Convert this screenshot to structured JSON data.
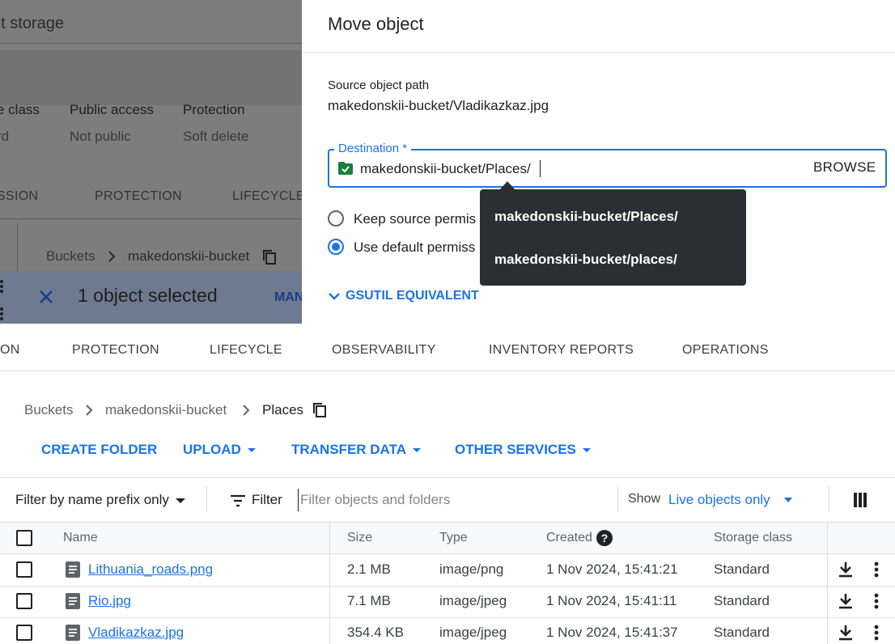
{
  "background_page": {
    "title": "et storage",
    "columns": [
      {
        "header": "e class",
        "value": "rd"
      },
      {
        "header": "Public access",
        "value": "Not public"
      },
      {
        "header": "Protection",
        "value": "Soft delete"
      }
    ],
    "tabs": [
      "SSION",
      "PROTECTION",
      "LIFECYCLE"
    ],
    "breadcrumb": [
      "Buckets",
      "makedonskii-bucket"
    ],
    "selection_text": "1 object selected",
    "selection_action": "MAN"
  },
  "dialog": {
    "title": "Move object",
    "source_label": "Source object path",
    "source_value": "makedonskii-bucket/Vladikazkaz.jpg",
    "destination_label": "Destination *",
    "destination_value": "makedonskii-bucket/Places/",
    "browse_label": "BROWSE",
    "radio_keep": "Keep source permis",
    "radio_default": "Use default permiss",
    "gsutil_label": "GSUTIL EQUIVALENT",
    "suggestions": [
      "makedonskii-bucket/Places/",
      "makedonskii-bucket/places/"
    ]
  },
  "tabs": [
    "ON",
    "PROTECTION",
    "LIFECYCLE",
    "OBSERVABILITY",
    "INVENTORY REPORTS",
    "OPERATIONS"
  ],
  "breadcrumb": [
    "Buckets",
    "makedonskii-bucket",
    "Places"
  ],
  "actions": [
    "CREATE FOLDER",
    "UPLOAD",
    "TRANSFER DATA",
    "OTHER SERVICES"
  ],
  "toolbar": {
    "filter_prefix": "Filter by name prefix only",
    "filter_label": "Filter",
    "filter_placeholder": "Filter objects and folders",
    "show_label": "Show",
    "show_value": "Live objects only"
  },
  "table": {
    "headers": [
      "Name",
      "Size",
      "Type",
      "Created",
      "Storage class"
    ],
    "rows": [
      {
        "name": "Lithuania_roads.png",
        "size": "2.1 MB",
        "type": "image/png",
        "created": "1 Nov 2024, 15:41:21",
        "storage_class": "Standard"
      },
      {
        "name": "Rio.jpg",
        "size": "7.1 MB",
        "type": "image/jpeg",
        "created": "1 Nov 2024, 15:41:11",
        "storage_class": "Standard"
      },
      {
        "name": "Vladikazkaz.jpg",
        "size": "354.4 KB",
        "type": "image/jpeg",
        "created": "1 Nov 2024, 15:41:37",
        "storage_class": "Standard"
      }
    ]
  },
  "colors": {
    "accent": "#1a73e8",
    "dropdown_bg": "#2d2e31",
    "folder_icon": "#188038"
  }
}
